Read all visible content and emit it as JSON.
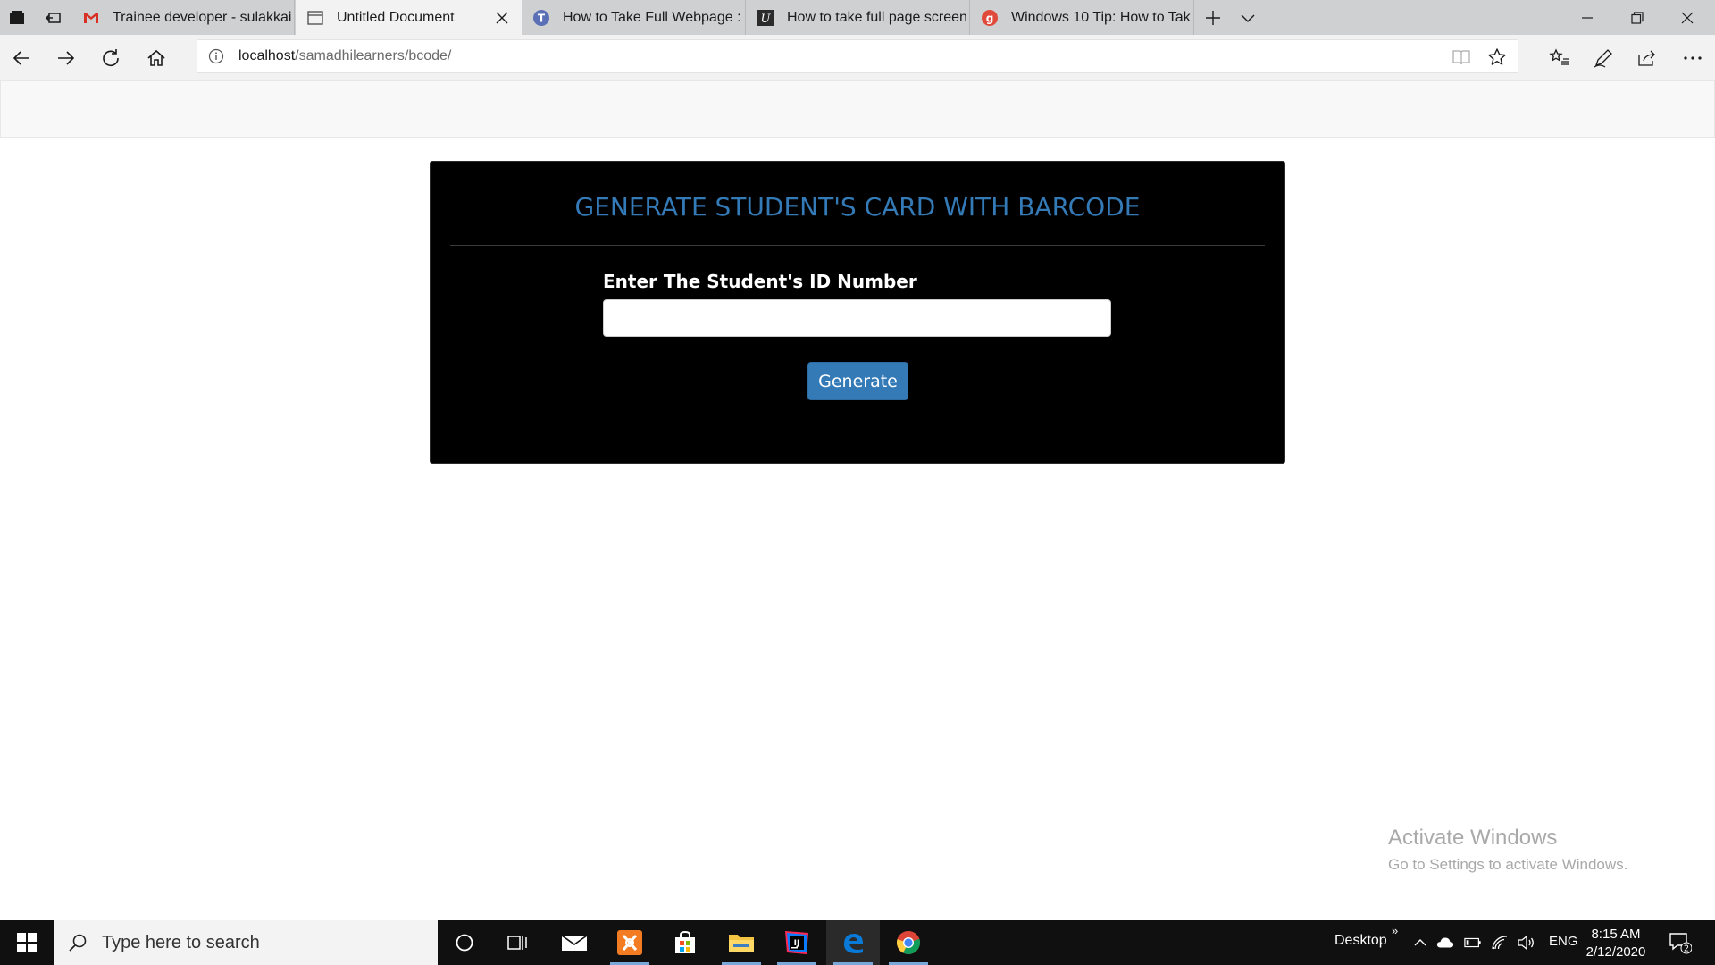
{
  "tabs": [
    {
      "title": "Trainee developer - sulakkai",
      "icon": "gmail-icon",
      "color": "#d93025"
    },
    {
      "title": "Untitled Document",
      "icon": "page-icon",
      "active": true
    },
    {
      "title": "How to Take Full Webpage :",
      "icon": "site-t-icon",
      "color": "#5a6fb6"
    },
    {
      "title": "How to take full page screen",
      "icon": "site-u-icon",
      "color": "#2b2b2b"
    },
    {
      "title": "Windows 10 Tip: How to Tak",
      "icon": "site-g-icon",
      "color": "#e04a3b"
    }
  ],
  "address": {
    "host": "localhost",
    "path": "/samadhilearners/bcode/"
  },
  "form": {
    "title": "GENERATE STUDENT'S CARD WITH BARCODE",
    "label": "Enter The Student's ID Number",
    "input_value": "",
    "button": "Generate"
  },
  "watermark": {
    "line1": "Activate Windows",
    "line2": "Go to Settings to activate Windows."
  },
  "taskbar": {
    "search_placeholder": "Type here to search",
    "desktop_label": "Desktop",
    "language": "ENG",
    "time": "8:15 AM",
    "date": "2/12/2020",
    "notification_count": "2"
  },
  "colors": {
    "accent": "#337ab7",
    "card_bg": "#000000",
    "taskbar_bg": "#101010"
  }
}
